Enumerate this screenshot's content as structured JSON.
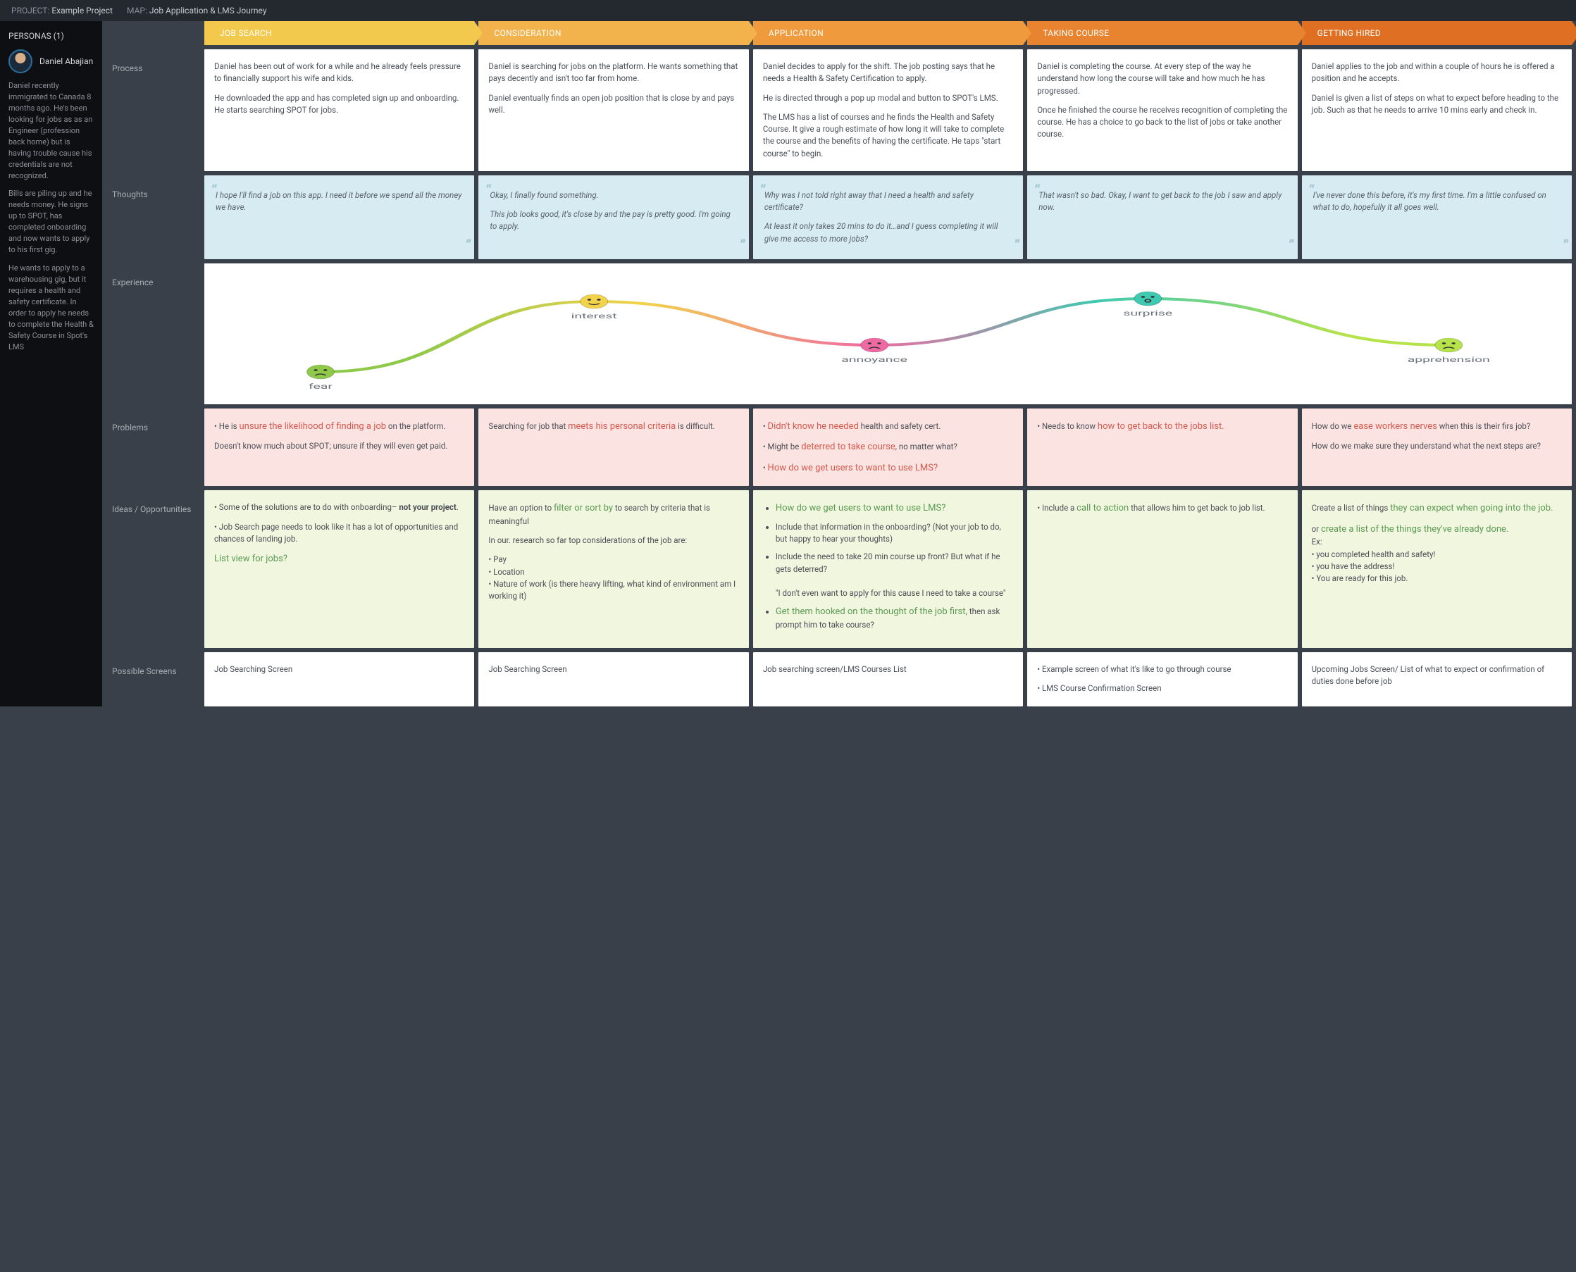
{
  "topbar": {
    "project_label": "PROJECT:",
    "project_value": "Example Project",
    "map_label": "MAP:",
    "map_value": "Job Application & LMS Journey"
  },
  "sidebar": {
    "header": "PERSONAS (1)",
    "persona": {
      "name": "Daniel Abajian",
      "p1": "Daniel recently immigrated to Canada 8 months ago. He's been looking for jobs as as an Engineer (profession back home) but is having trouble cause his credentials are not recognized.",
      "p2": "Bills are piling up and he needs money. He signs up to SPOT, has completed onboarding and now wants to apply to his first gig.",
      "p3": "He wants to apply to a warehousing gig, but it requires a health and safety certificate. In order to apply he needs to complete the Health & Safety Course in Spot's LMS"
    }
  },
  "stages": [
    {
      "label": "JOB SEARCH",
      "bg": "#f2c94c",
      "arrow": "#f2c94c"
    },
    {
      "label": "CONSIDERATION",
      "bg": "#f2b24c",
      "arrow": "#f2b24c"
    },
    {
      "label": "APPLICATION",
      "bg": "#ef9a3c",
      "arrow": "#ef9a3c"
    },
    {
      "label": "TAKING COURSE",
      "bg": "#e8842f",
      "arrow": "#e8842f"
    },
    {
      "label": "GETTING HIRED",
      "bg": "#df6f22",
      "arrow": "#df6f22"
    }
  ],
  "rows": {
    "process": {
      "label": "Process",
      "cells": [
        [
          "Daniel has been out of work for a while and he already feels pressure to financially support his wife and kids.",
          "He downloaded the app and has completed sign up and onboarding. He starts searching SPOT for jobs."
        ],
        [
          "Daniel is searching for jobs on the platform. He wants something that pays decently and isn't too far from home.",
          "Daniel eventually finds an open job position that is close by and pays well."
        ],
        [
          "Daniel decides to apply for the shift. The job posting says that he needs a Health & Safety Certification to apply.",
          "He is directed through a pop up modal and button to SPOT's LMS.",
          "The LMS has a list of courses and he finds the Health and Safety Course. It give a rough estimate of how long it will take to complete the course and the benefits of having the certificate. He taps \"start course\" to begin."
        ],
        [
          "Daniel is completing the course. At every step of the way he understand how long the course will take and how much he has progressed.",
          "Once he finished the course he receives recognition of completing the course. He has a choice to go back to the list of jobs or take another course."
        ],
        [
          "Daniel applies to the job and within a couple of hours he is offered a position and he accepts.",
          "Daniel is given a list of steps on what to expect before heading to the job. Such as that he needs to arrive 10 mins early and check in."
        ]
      ]
    },
    "thoughts": {
      "label": "Thoughts",
      "cells": [
        [
          "I hope I'll find a job on this app. I need it before we spend all the money we have."
        ],
        [
          "Okay, I finally found something.",
          "This job looks good, it's close by and the pay is pretty good. I'm going to apply."
        ],
        [
          "Why was I not told right away that I need a health and safety certificate?",
          "At least it only takes 20 mins to do it…and I guess completing it will give me access to more jobs?"
        ],
        [
          "That wasn't so bad. Okay, I want to get back to the job I saw and apply now."
        ],
        [
          "I've never done this before, it's my first time. I'm a little confused on what to do, hopefully it all goes well."
        ]
      ]
    },
    "experience": {
      "label": "Experience",
      "points": [
        {
          "x": 0.085,
          "y": 0.77,
          "label": "fear",
          "color": "#8fc94a"
        },
        {
          "x": 0.285,
          "y": 0.27,
          "label": "interest",
          "color": "#f2d34c"
        },
        {
          "x": 0.49,
          "y": 0.58,
          "label": "annoyance",
          "color": "#ef6aa3"
        },
        {
          "x": 0.69,
          "y": 0.25,
          "label": "surprise",
          "color": "#3fc9b0"
        },
        {
          "x": 0.91,
          "y": 0.58,
          "label": "apprehension",
          "color": "#b6e24a"
        }
      ]
    },
    "problems": {
      "label": "Problems",
      "cells": [
        {
          "html": "<p><span class='bullet'></span>He is <span class='hl'>unsure the likelihood of finding a job</span> on the platform.</p><p>Doesn't know much about SPOT; unsure if they will even get paid.</p>"
        },
        {
          "html": "<p>Searching for job that <span class='hl'>meets his personal criteria</span> is difficult.</p>"
        },
        {
          "html": "<p><span class='bullet'></span><span class='hl'>Didn't know he needed</span> health and safety cert.</p><p><span class='bullet'></span>Might be <span class='hl'>deterred to take course</span>, no matter what?</p><p><span class='bullet'></span><span class='hl'>How do we get users to want to use LMS?</span></p>"
        },
        {
          "html": "<p><span class='bullet'></span>Needs to know <span class='hl'>how to get back to the jobs list.</span></p>"
        },
        {
          "html": "<p>How do we <span class='hl'>ease workers nerves</span> when this is their firs job?</p><p>How do we make sure they understand what the next steps are?</p>"
        }
      ]
    },
    "ideas": {
      "label": "Ideas / Opportunities",
      "cells": [
        {
          "html": "<p><span class='bullet'></span>Some of the solutions are to do with onboarding– <b>not your project</b>.</p><p><span class='bullet'></span>Job Search page needs to look like it has a lot of opportunities and chances of landing job.</p><p><span class='hl'>List view for jobs?</span></p>"
        },
        {
          "html": "<p>Have an option to <span class='hl'>filter or sort by</span> to search by criteria that is meaningful</p><p>In our. research so far top considerations of the job are:</p><p><span class='bullet'></span>Pay<br><span class='bullet'></span>Location<br><span class='bullet'></span>Nature of work (is there heavy lifting, what kind of environment am I working it)</p>"
        },
        {
          "html": "<ul><li><span class='hl'>How do we get users to want to use LMS?</span></li><li>Include that information in the onboarding? (Not your job to do, but happy to hear your thoughts)</li><li>Include the need to take 20 min course up front? But what if he gets deterred?<br><br>\"I don't even want to apply for this cause I need to take a course\"</li><li><span class='hl'>Get them hooked on the thought of the job first,</span> then ask prompt him to take course?</li></ul>"
        },
        {
          "html": "<p><span class='bullet'></span>Include a <span class='hl'>call to action</span> that allows him to get back to job list.</p>"
        },
        {
          "html": "<p>Create a list of things <span class='hl'>they can expect when going into the job.</span></p><p>or <span class='hl'>create a list of the things they've already done.</span><br>Ex:<br><span class='bullet'></span>you completed health and safety!<br><span class='bullet'></span>you have the address!<br><span class='bullet'></span>You are ready for this job.</p>"
        }
      ]
    },
    "screens": {
      "label": "Possible Screens",
      "cells": [
        [
          "Job Searching Screen"
        ],
        [
          "Job Searching Screen"
        ],
        [
          "Job searching screen/LMS Courses List"
        ],
        [
          "• Example screen of what it's like to go through course",
          "• LMS Course Confirmation Screen"
        ],
        [
          "Upcoming Jobs Screen/ List of what to expect or confirmation of duties done before job"
        ]
      ]
    }
  }
}
